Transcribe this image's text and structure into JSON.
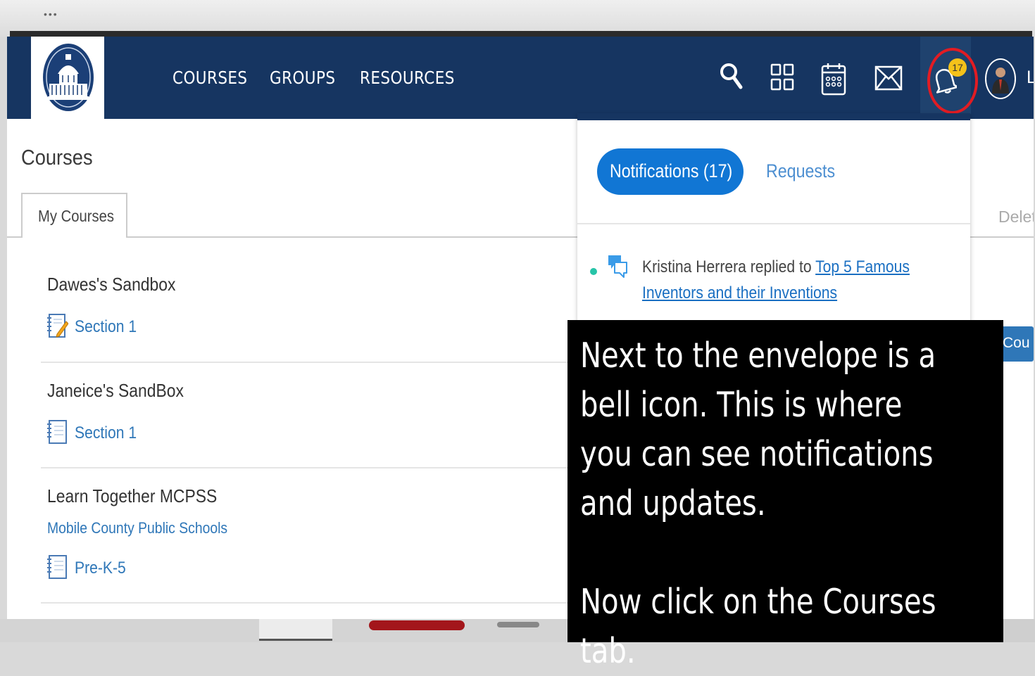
{
  "nav": {
    "links": [
      "COURSES",
      "GROUPS",
      "RESOURCES"
    ],
    "notification_count": "17",
    "cut_text": "L"
  },
  "icons": {
    "search": "search-icon",
    "apps": "grid-icon",
    "calendar": "calendar-icon",
    "messages": "envelope-icon",
    "notifications": "bell-icon"
  },
  "colors": {
    "nav_bg": "#163561",
    "accent_blue": "#1176d4",
    "link_blue": "#2f77b8",
    "badge_yellow": "#f4c21a",
    "highlight_red": "#e21c23"
  },
  "page": {
    "title": "Courses",
    "tab_label": "My Courses",
    "delete_cut": "Delete",
    "button_cut": "Cou"
  },
  "courses": [
    {
      "title": "Dawes's Sandbox",
      "subtitle": "",
      "section": "Section 1"
    },
    {
      "title": "Janeice's SandBox",
      "subtitle": "",
      "section": "Section 1"
    },
    {
      "title": "Learn Together MCPSS",
      "subtitle": "Mobile County Public Schools",
      "section": "Pre-K-5"
    }
  ],
  "dropdown": {
    "tab_notifications": "Notifications (17)",
    "tab_requests": "Requests",
    "item": {
      "actor": "Kristina Herrera",
      "verb": " replied to ",
      "link": "Top 5 Famous Inventors and their Inventions"
    }
  },
  "overlay": {
    "text": "Next to the envelope is a bell icon. This is where you can see notifications and updates.\n\nNow click on the Courses tab."
  }
}
